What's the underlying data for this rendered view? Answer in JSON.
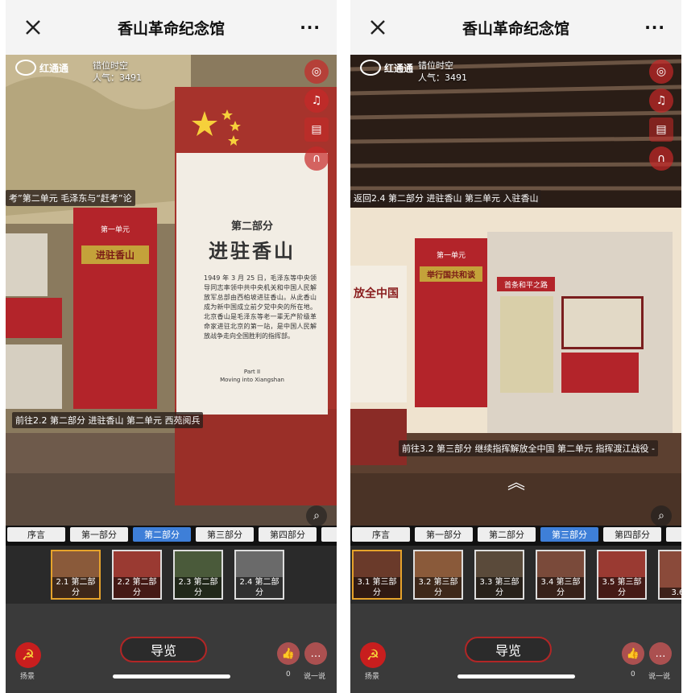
{
  "app": {
    "title": "香山革命纪念馆",
    "more": "···"
  },
  "logo": {
    "text": "红通通"
  },
  "info": {
    "place": "错位时空",
    "popularity": "人气：3491"
  },
  "phone1": {
    "hotspots": [
      "考”第二单元 毛泽东与“赶考”论",
      "前往2.2 第二部分 进驻香山 第二单元 西苑阅兵"
    ],
    "board": {
      "part": "第二部分",
      "title": "进驻香山",
      "body": "1949 年 3 月 25 日，毛泽东等中央领导同志率领中共中央机关和中国人民解放军总部由西柏坡进驻香山。从此香山成为新中国成立前夕党中央的所在地。北京香山是毛泽东等老一辈无产阶级革命家进驻北京的第一站，是中国人民解放战争走向全国胜利的指挥部。",
      "subtitle": "Part II",
      "subtitle2": "Moving into Xiangshan"
    },
    "panel": {
      "unit": "第一单元",
      "title": "进驻香山"
    },
    "tabs": [
      "序言",
      "第一部分",
      "第二部分",
      "第三部分",
      "第四部分",
      "第"
    ],
    "active_tab": 2,
    "thumbs": [
      "2.1 第二部分",
      "2.2 第二部分",
      "2.3 第二部分",
      "2.4 第二部分"
    ]
  },
  "phone2": {
    "hotspots": [
      "返回2.4 第二部分 进驻香山 第三单元 入驻香山",
      "前往3.2 第三部分 继续指挥解放全中国 第二单元 指挥渡江战役 -"
    ],
    "panel": {
      "unit": "第一单元",
      "title": "举行国共和谈"
    },
    "left_label": "放全中国",
    "sign": "首条和平之路",
    "tabs": [
      "序言",
      "第一部分",
      "第二部分",
      "第三部分",
      "第四部分",
      "第"
    ],
    "active_tab": 3,
    "thumbs": [
      "3.1 第三部分",
      "3.2 第三部分",
      "3.3 第三部分",
      "3.4 第三部分",
      "3.5 第三部分",
      "3.6 第"
    ]
  },
  "bottom": {
    "guide": "导览",
    "badge_label": "扬景",
    "like_count": "0",
    "chat_label": "说一说"
  },
  "colors": {
    "accent_red": "#b3242a",
    "tab_active": "#3e7fd8",
    "thumb_selected": "#e6a32b"
  }
}
